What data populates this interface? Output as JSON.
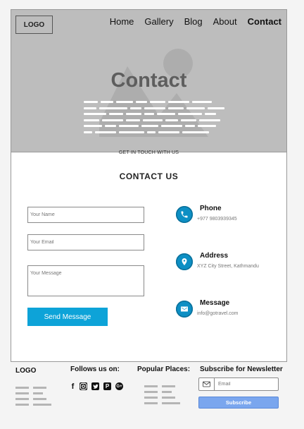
{
  "header": {
    "logo": "LOGO",
    "nav": [
      {
        "label": "Home",
        "active": false
      },
      {
        "label": "Gallery",
        "active": false
      },
      {
        "label": "Blog",
        "active": false
      },
      {
        "label": "About",
        "active": false
      },
      {
        "label": "Contact",
        "active": true
      }
    ]
  },
  "hero": {
    "title": "Contact"
  },
  "contact": {
    "kicker": "GET IN TOUCH WITH US",
    "title": "CONTACT US",
    "form": {
      "name_placeholder": "Your Name",
      "email_placeholder": "Your Email",
      "message_placeholder": "Your Message",
      "submit_label": "Send Message"
    },
    "info": [
      {
        "icon": "phone-icon",
        "title": "Phone",
        "value": "+977 9803939345"
      },
      {
        "icon": "location-pin-icon",
        "title": "Address",
        "value": "XYZ City Street, Kathmandu"
      },
      {
        "icon": "envelope-icon",
        "title": "Message",
        "value": "info@gotravel.com"
      }
    ]
  },
  "footer": {
    "logo": "LOGO",
    "follow_title": "Follows us on:",
    "social_icons": [
      "facebook-icon",
      "instagram-icon",
      "twitter-icon",
      "pinterest-icon",
      "google-plus-icon"
    ],
    "places_title": "Popular Places:",
    "newsletter_title": "Subscribe for Newsletter",
    "email_placeholder": "Email",
    "subscribe_label": "Subscribe"
  },
  "colors": {
    "accent": "#0da3d8",
    "hero_bg": "#bdbdbd",
    "subscribe_bg": "#7aa6ee"
  }
}
